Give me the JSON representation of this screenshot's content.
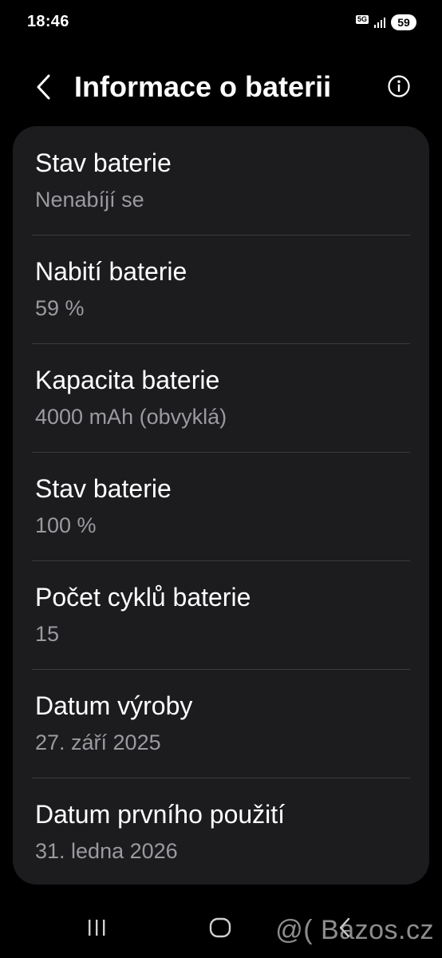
{
  "status_bar": {
    "time": "18:46",
    "network_badge": "5G",
    "battery_level": "59",
    "signal_icon": "signal-bars-icon"
  },
  "header": {
    "back_icon": "chevron-left-icon",
    "title": "Informace o baterii",
    "info_icon": "info-circle-icon"
  },
  "battery_info": {
    "items": [
      {
        "title": "Stav baterie",
        "value": "Nenabíjí se"
      },
      {
        "title": "Nabití baterie",
        "value": "59 %"
      },
      {
        "title": "Kapacita baterie",
        "value": "4000 mAh (obvyklá)"
      },
      {
        "title": "Stav baterie",
        "value": "100 %"
      },
      {
        "title": "Počet cyklů baterie",
        "value": "15"
      },
      {
        "title": "Datum výroby",
        "value": "27. září 2025"
      },
      {
        "title": "Datum prvního použití",
        "value": "31. ledna 2026"
      }
    ]
  },
  "nav_bar": {
    "recents_icon": "recent-apps-icon",
    "home_icon": "home-icon",
    "back_icon": "back-chevron-icon"
  },
  "watermark": "@( Bazos.cz",
  "colors": {
    "background": "#000000",
    "card": "#1c1c1f",
    "primary_text": "#ffffff",
    "secondary_text": "#9a9a9f",
    "divider": "#3a3a3e"
  }
}
